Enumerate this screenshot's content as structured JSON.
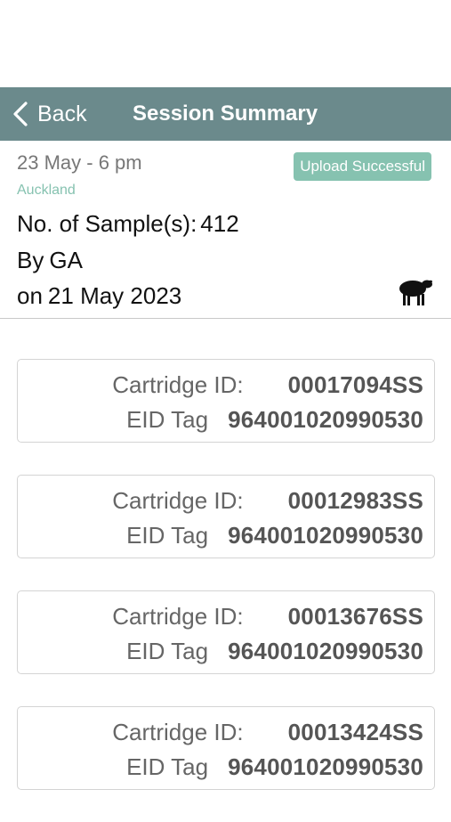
{
  "nav": {
    "back_label": "Back",
    "title": "Session Summary"
  },
  "session": {
    "name": "23 May - 6 pm",
    "status": "Upload Successful",
    "location": "Auckland",
    "samples_label": "No. of Sample(s):",
    "samples_value": "412",
    "by_label": "By",
    "by_value": "GA",
    "date_label": "on",
    "date_value": "21 May 2023",
    "animal_icon": "sheep-icon"
  },
  "colors": {
    "nav_bar": "#6b8a8c",
    "status_badge": "#86c2b0",
    "location_text": "#86c2b0"
  },
  "samples": [
    {
      "cartridge_label": "Cartridge ID:",
      "cartridge_id": "00017094SS",
      "eid_label": "EID Tag",
      "eid_tag": "964001020990530"
    },
    {
      "cartridge_label": "Cartridge ID:",
      "cartridge_id": "00012983SS",
      "eid_label": "EID Tag",
      "eid_tag": "964001020990530"
    },
    {
      "cartridge_label": "Cartridge ID:",
      "cartridge_id": "00013676SS",
      "eid_label": "EID Tag",
      "eid_tag": "964001020990530"
    },
    {
      "cartridge_label": "Cartridge ID:",
      "cartridge_id": "00013424SS",
      "eid_label": "EID Tag",
      "eid_tag": "964001020990530"
    }
  ]
}
